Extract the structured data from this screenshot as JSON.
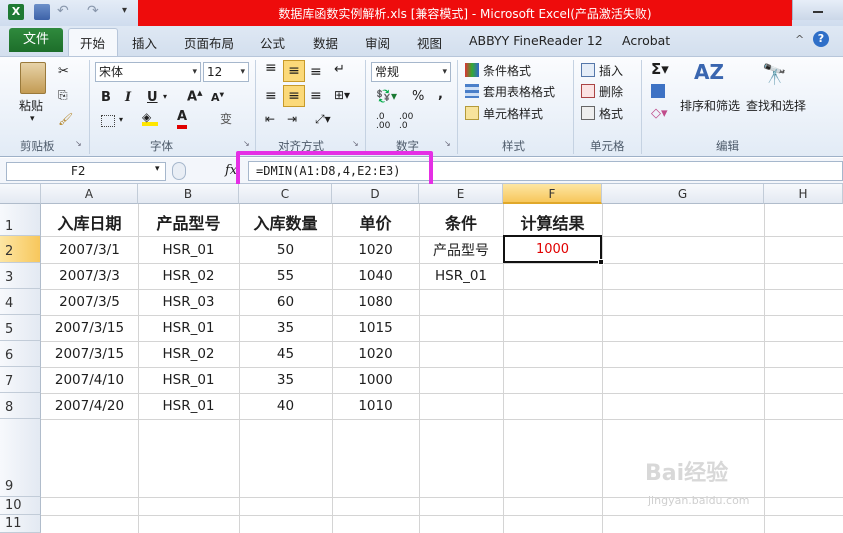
{
  "window": {
    "title": "数据库函数实例解析.xls  [兼容模式]  -  Microsoft Excel(产品激活失败)"
  },
  "tabs": {
    "file": "文件",
    "items": [
      "开始",
      "插入",
      "页面布局",
      "公式",
      "数据",
      "审阅",
      "视图",
      "ABBYY FineReader 12",
      "Acrobat"
    ]
  },
  "ribbon": {
    "paste": "粘贴",
    "font_name": "宋体",
    "font_size": "12",
    "number_format": "常规",
    "cond_format": "条件格式",
    "table_format": "套用表格格式",
    "cell_style": "单元格样式",
    "insert": "插入",
    "delete": "删除",
    "format": "格式",
    "sort_filter": "排序和筛选",
    "find_select": "查找和选择",
    "groups": {
      "clipboard": "剪贴板",
      "font": "字体",
      "alignment": "对齐方式",
      "number": "数字",
      "styles": "样式",
      "cells": "单元格",
      "editing": "编辑"
    }
  },
  "formula_bar": {
    "name_box": "F2",
    "fx": "fx",
    "formula": "=DMIN(A1:D8,4,E2:E3)",
    "highlight_color": "#e52fe5"
  },
  "sheet": {
    "columns": [
      "A",
      "B",
      "C",
      "D",
      "E",
      "F",
      "G",
      "H"
    ],
    "rows": [
      "1",
      "2",
      "3",
      "4",
      "5",
      "6",
      "7",
      "8",
      "9",
      "10",
      "11"
    ],
    "headers": [
      "入库日期",
      "产品型号",
      "入库数量",
      "单价",
      "条件",
      "计算结果"
    ],
    "data": [
      [
        "2007/3/1",
        "HSR_01",
        "50",
        "1020"
      ],
      [
        "2007/3/3",
        "HSR_02",
        "55",
        "1040"
      ],
      [
        "2007/3/5",
        "HSR_03",
        "60",
        "1080"
      ],
      [
        "2007/3/15",
        "HSR_01",
        "35",
        "1015"
      ],
      [
        "2007/3/15",
        "HSR_02",
        "45",
        "1020"
      ],
      [
        "2007/4/10",
        "HSR_01",
        "35",
        "1000"
      ],
      [
        "2007/4/20",
        "HSR_01",
        "40",
        "1010"
      ]
    ],
    "criteria": [
      "产品型号",
      "HSR_01"
    ],
    "result": "1000",
    "result_color": "#e00000"
  },
  "watermark": {
    "brand": "Bai经验",
    "url": "jingyan.baidu.com"
  }
}
